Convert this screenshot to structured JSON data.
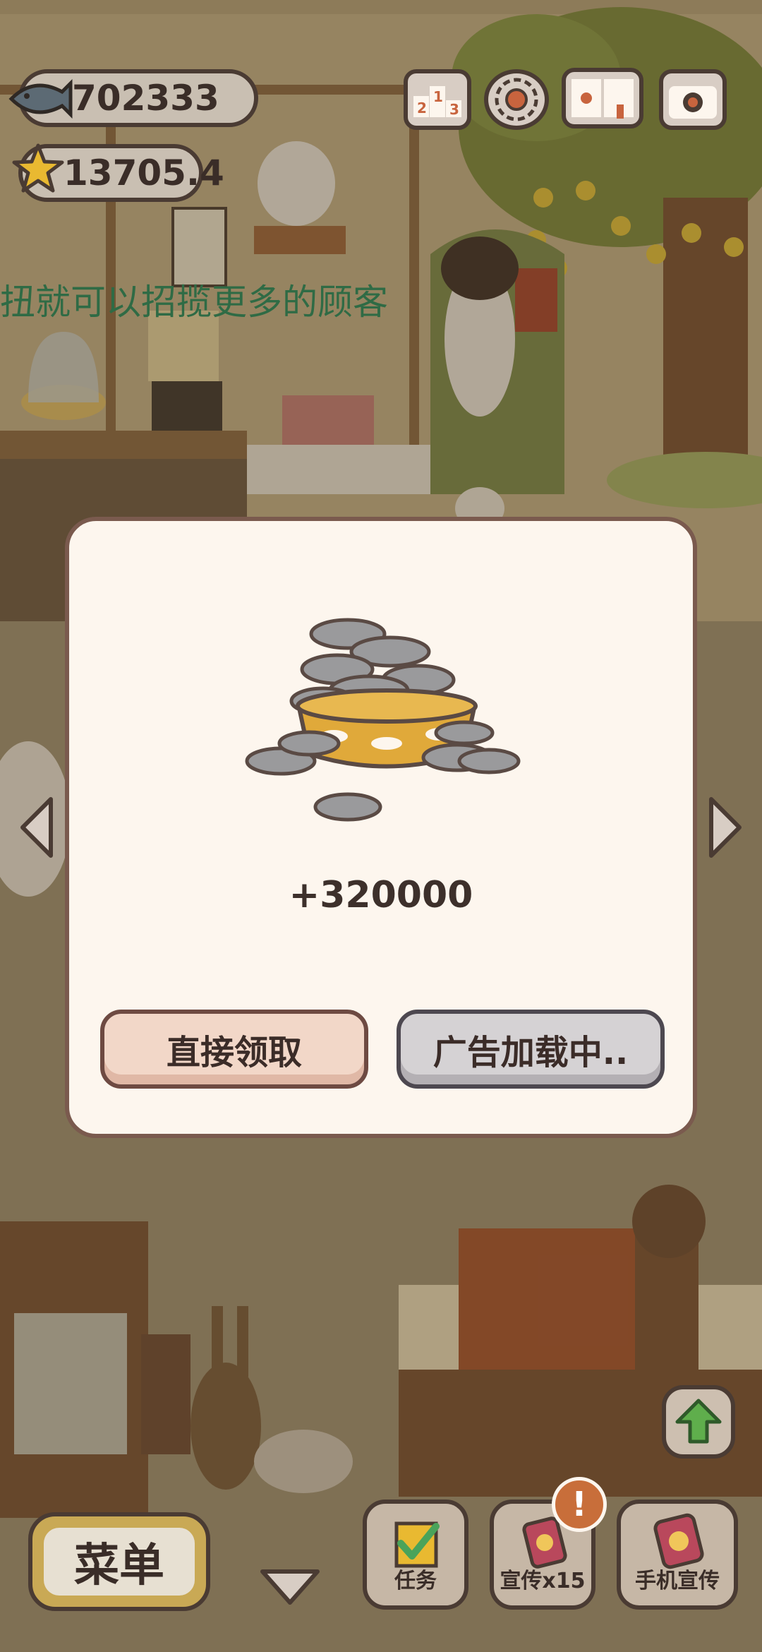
{
  "resources": {
    "fish": "702333",
    "stars": "13705.4"
  },
  "top_icons": [
    "ranking-icon",
    "gear-icon",
    "guide-book-icon",
    "camera-icon"
  ],
  "marquee_text": "扭就可以招揽更多的顾客",
  "reward": {
    "amount": "+320000"
  },
  "buttons": {
    "claim": "直接领取",
    "ad_loading": "广告加载中.."
  },
  "bottom": {
    "menu": "菜单",
    "tasks": "任务",
    "promote": "宣传x15",
    "phone_promote": "手机宣传"
  },
  "colors": {
    "dialog_bg": "#fdf6ee",
    "claim_button": "#f2d7c8",
    "ad_button": "#d5d2d4",
    "bowl": "#e0a93a",
    "fish": "#9a9a9c",
    "notification": "#c86e3a"
  }
}
